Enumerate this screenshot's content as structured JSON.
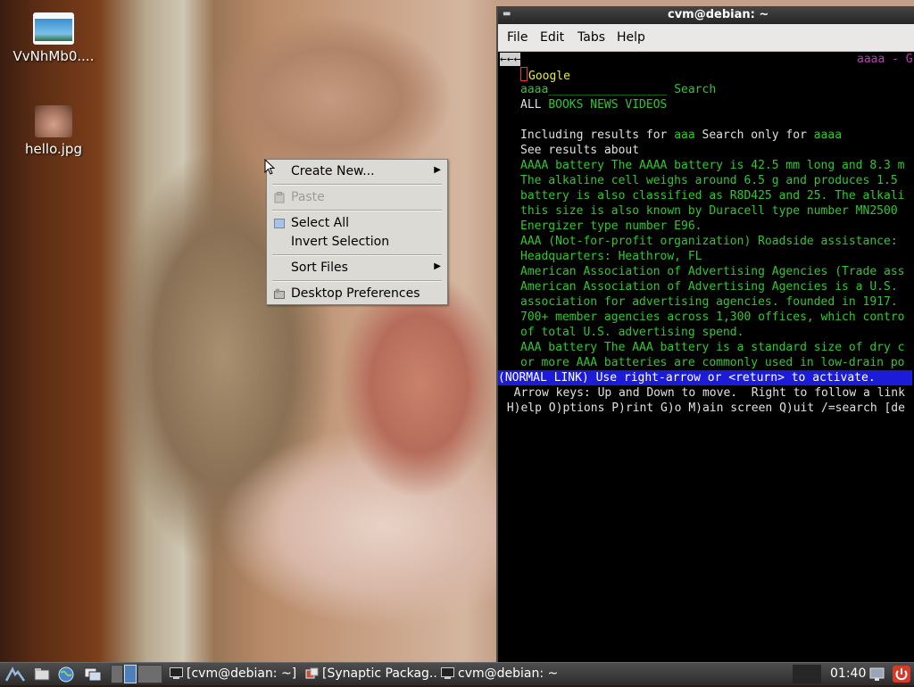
{
  "desktop": {
    "icons": [
      {
        "label": "VvNhMb0....",
        "type": "image-file-icon"
      },
      {
        "label": "hello.jpg",
        "type": "photo-thumbnail-icon"
      }
    ]
  },
  "context_menu": {
    "items": [
      {
        "label": "Create New...",
        "submenu": true,
        "enabled": true
      },
      {
        "label": "Paste",
        "enabled": false,
        "icon": "paste-icon"
      },
      {
        "label": "Select All",
        "enabled": true,
        "icon": "select-all-icon"
      },
      {
        "label": "Invert Selection",
        "enabled": true
      },
      {
        "label": "Sort Files",
        "submenu": true,
        "enabled": true
      },
      {
        "label": "Desktop Preferences",
        "enabled": true,
        "icon": "preferences-icon"
      }
    ],
    "submenu_arrow": "▶"
  },
  "terminal": {
    "title": "cvm@debian: ~",
    "menu": [
      "File",
      "Edit",
      "Tabs",
      "Help"
    ],
    "top_arrow": "←←←",
    "top_right": "aaaa - G",
    "brand": "Google",
    "search_query": "aaaa",
    "search_field_blank": "_________________",
    "search_button": "Search",
    "nav_all": "ALL",
    "nav_links": "BOOKS NEWS VIDEOS",
    "including_prefix": "Including results for ",
    "including_term": "aaa",
    "search_only_prefix": " Search only for ",
    "search_only_term": "aaaa",
    "see_results": "See results about",
    "results": [
      "AAAA battery The AAAA battery is 42.5 mm long and 8.3 m",
      "The alkaline cell weighs around 6.5 g and produces 1.5",
      "battery is also classified as R8D425 and 25. The alkali",
      "this size is also known by Duracell type number MN2500",
      "Energizer type number E96.",
      "AAA (Not-for-profit organization) Roadside assistance:",
      "Headquarters: Heathrow, FL",
      "American Association of Advertising Agencies (Trade ass",
      "American Association of Advertising Agencies is a U.S.",
      "association for advertising agencies. founded in 1917.",
      "700+ member agencies across 1,300 offices, which contro",
      "of total U.S. advertising spend.",
      "AAA battery The AAA battery is a standard size of dry c",
      "or more AAA batteries are commonly used in low-drain po"
    ],
    "status_line": "(NORMAL LINK) Use right-arrow or <return> to activate.",
    "help_line_1": "  Arrow keys: Up and Down to move.  Right to follow a link",
    "help_line_2": " H)elp O)ptions P)rint G)o M)ain screen Q)uit /=search [de"
  },
  "taskbar": {
    "tasks": [
      {
        "label": "[cvm@debian: ~]",
        "icon": "terminal-icon"
      },
      {
        "label": "[Synaptic Packag...",
        "icon": "synaptic-icon"
      },
      {
        "label": "cvm@debian: ~",
        "icon": "terminal-icon"
      }
    ],
    "clock": "01:40"
  },
  "colors": {
    "terminal_green": "#2fc82f",
    "terminal_magenta": "#c832c8",
    "status_bar_blue": "#1b1bd8"
  }
}
